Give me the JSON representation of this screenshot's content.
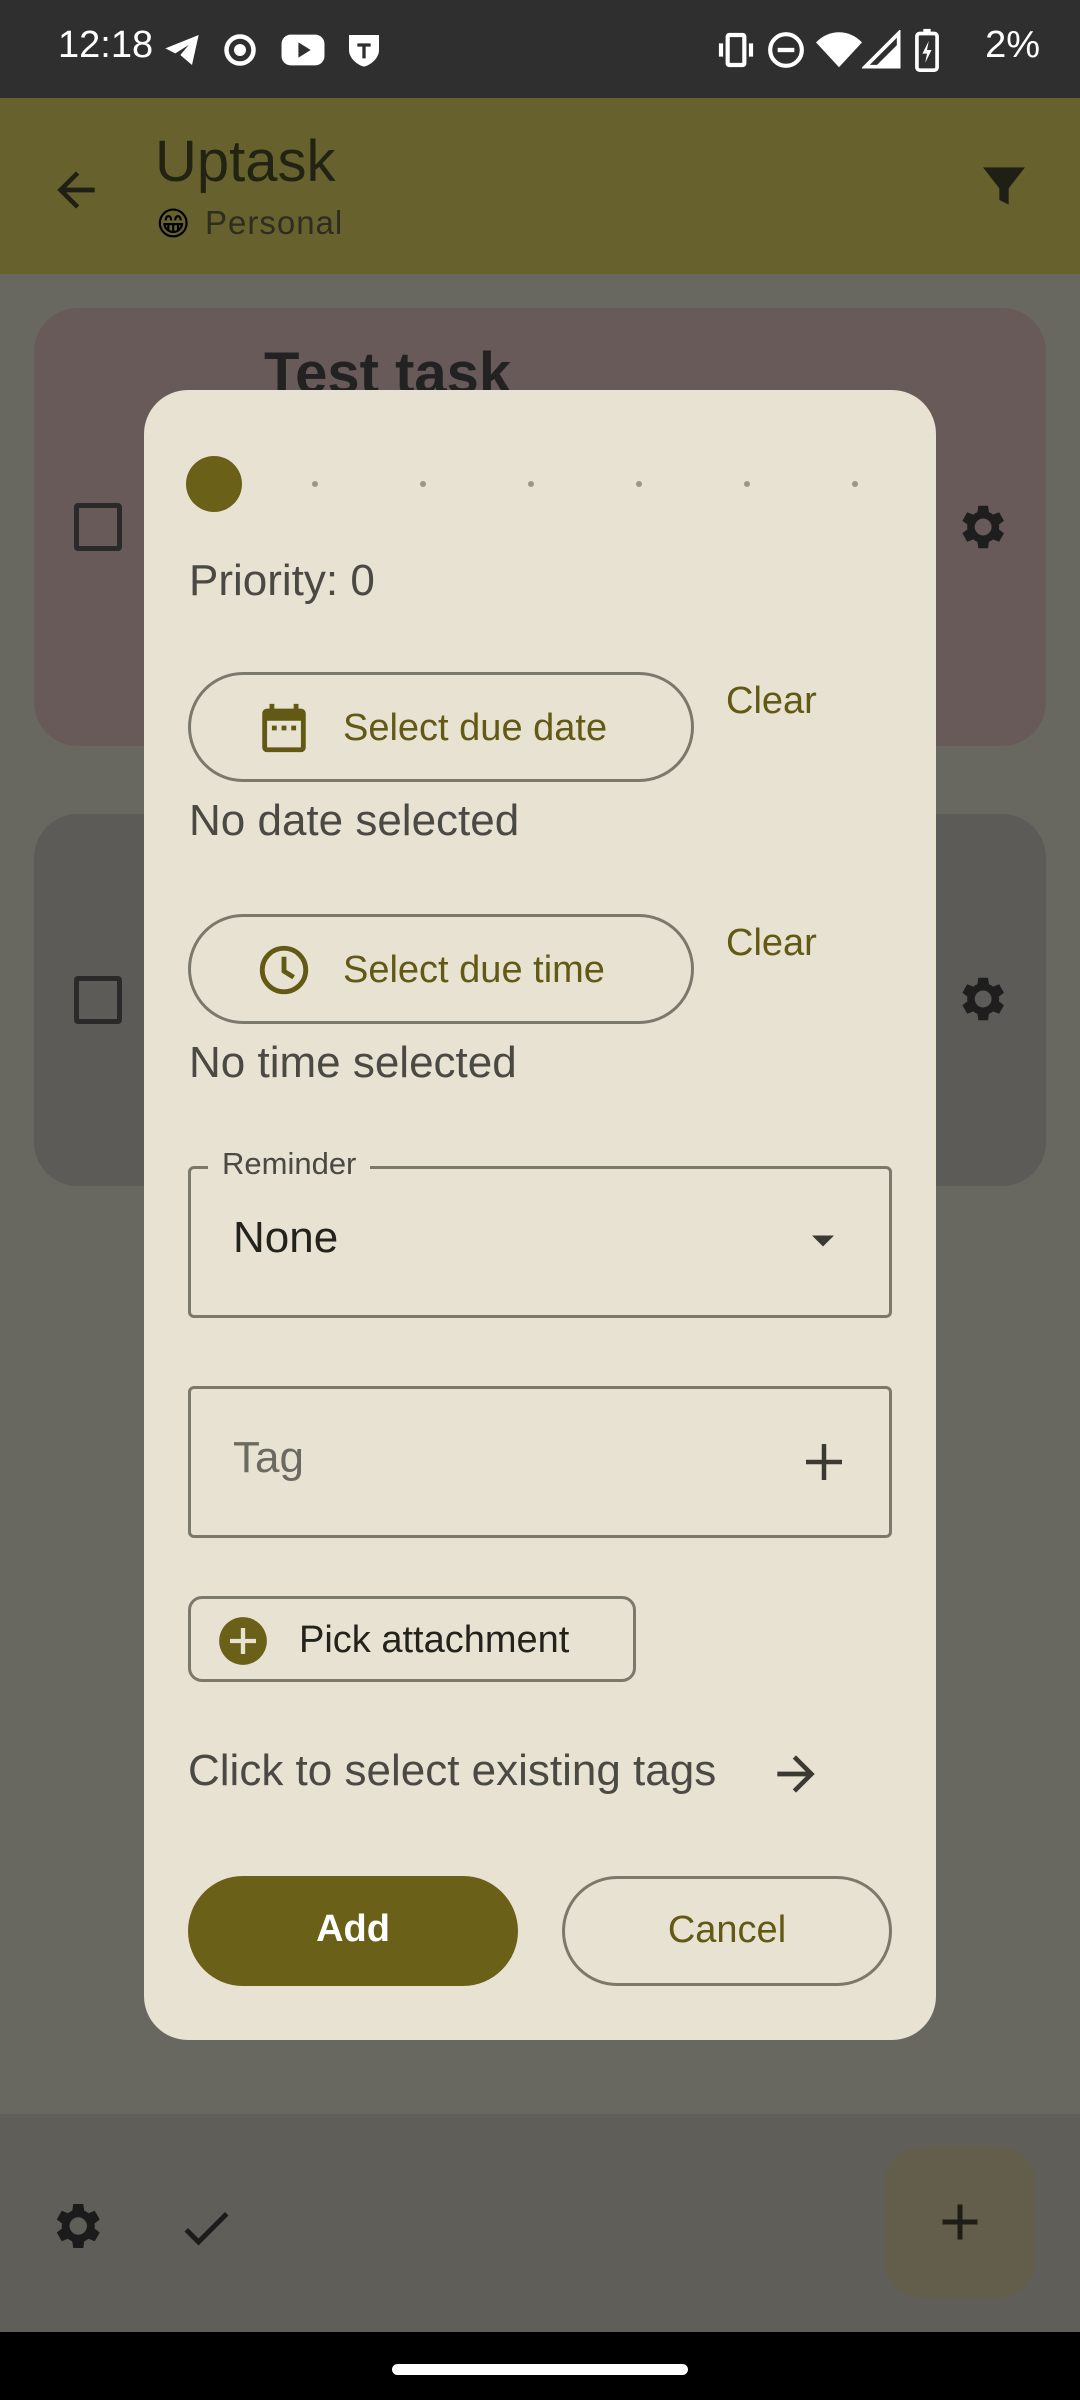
{
  "status_bar": {
    "time": "12:18",
    "battery": "2%"
  },
  "app_bar": {
    "title": "Uptask",
    "subtitle": "Personal",
    "subtitle_emoji": "😁"
  },
  "background": {
    "task1_title": "Test task"
  },
  "dialog": {
    "priority_label": "Priority: 0",
    "due_date_button": "Select due date",
    "clear_date": "Clear",
    "date_status": "No date selected",
    "due_time_button": "Select due time",
    "clear_time": "Clear",
    "time_status": "No time selected",
    "reminder": {
      "label": "Reminder",
      "value": "None"
    },
    "tag": {
      "placeholder": "Tag"
    },
    "pick_attachment": "Pick attachment",
    "existing_tags_link": "Click to select existing tags",
    "add_button": "Add",
    "cancel_button": "Cancel",
    "priority": 0
  },
  "colors": {
    "accent": "#6b6018",
    "dialog_bg": "#e8e2d2",
    "scrim": "#686760"
  }
}
